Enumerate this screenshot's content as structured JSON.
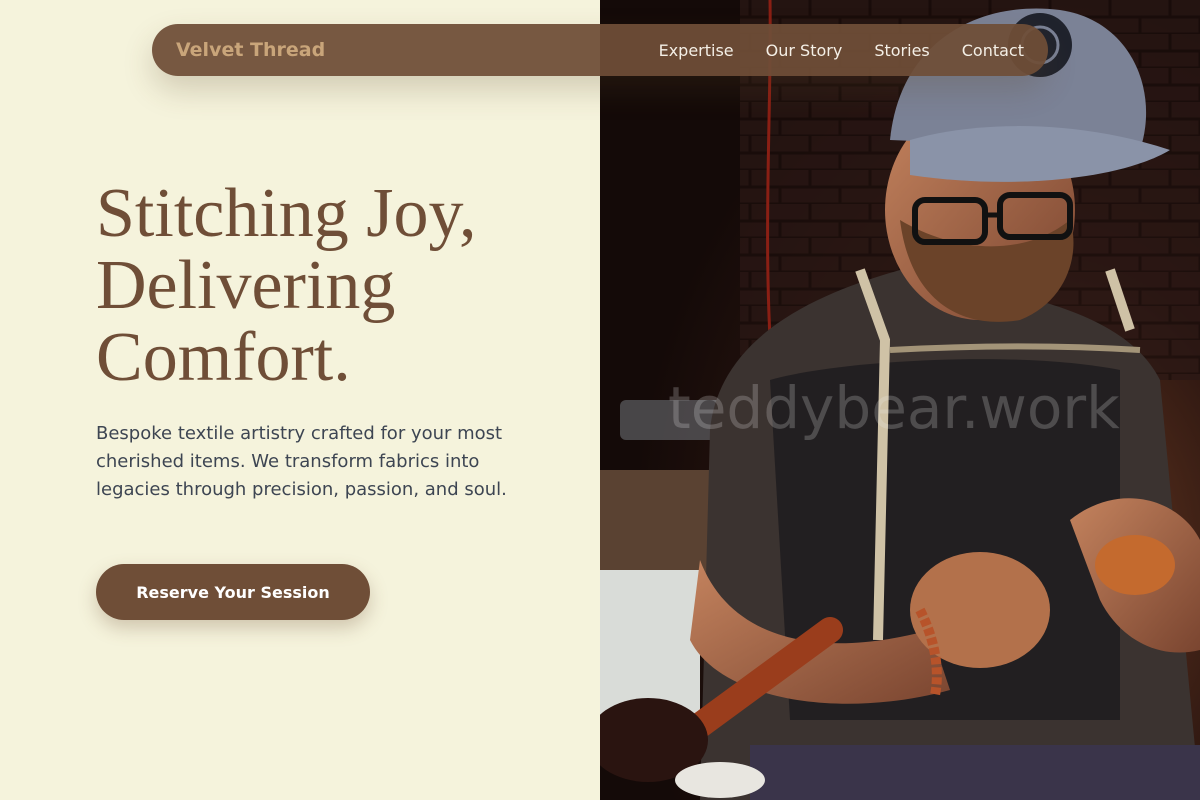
{
  "nav": {
    "brand": "Velvet Thread",
    "links": [
      "Expertise",
      "Our Story",
      "Stories",
      "Contact"
    ]
  },
  "hero": {
    "headline_lines": [
      "Stitching Joy,",
      "Delivering",
      "Comfort."
    ],
    "subcopy": "Bespoke textile artistry crafted for your most cherished items. We transform fabrics into legacies through precision, passion, and soul.",
    "cta_label": "Reserve Your Session"
  },
  "photo": {
    "watermark": "teddybear.work"
  },
  "colors": {
    "background": "#f5f3dc",
    "accent": "#6f4e37",
    "brand_text": "#c9a57a",
    "body_text": "#3d4552"
  }
}
